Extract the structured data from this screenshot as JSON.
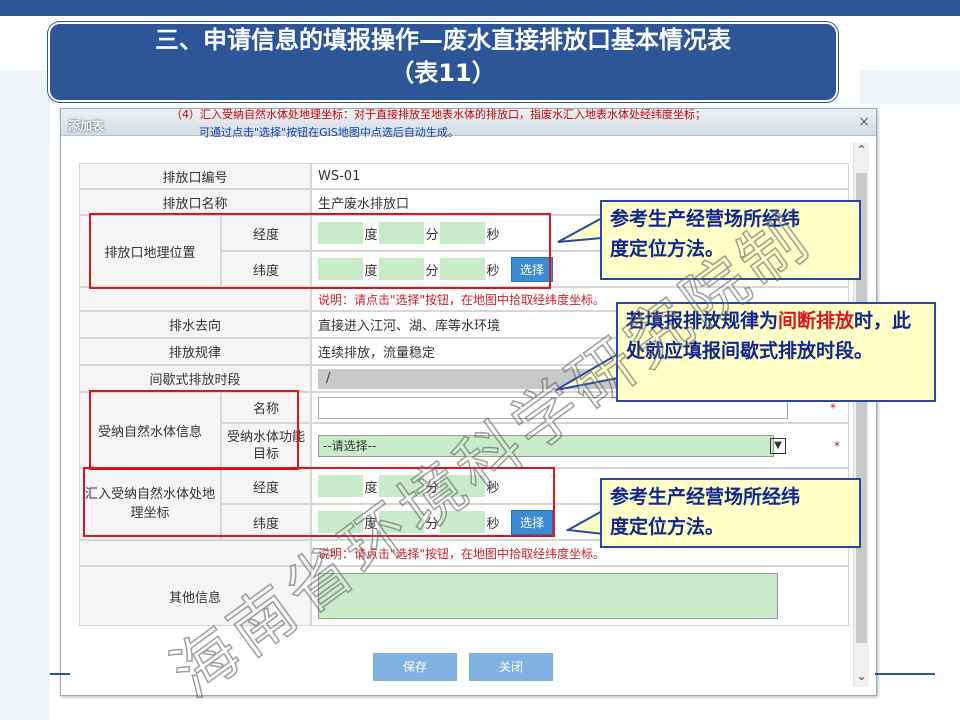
{
  "slide": {
    "title_line1": "三、申请信息的填报操作—废水直接排放口基本情况表",
    "title_line2": "（表11）"
  },
  "dialog": {
    "title": "添加表",
    "note_red": "（4）汇入受纳自然水体处地理坐标：对于直接排放至地表水体的排放口，指废水汇入地表水体处经纬度坐标；",
    "note_blue": "可通过点击\"选择\"按钮在GIS地图中点选后自动生成。",
    "close_glyph": "×"
  },
  "form": {
    "outlet_no_label": "排放口编号",
    "outlet_no_value": "WS-01",
    "outlet_name_label": "排放口名称",
    "outlet_name_value": "生产废水排放口",
    "geo_label": "排放口地理位置",
    "longitude_label": "经度",
    "latitude_label": "纬度",
    "unit_degree": "度",
    "unit_minute": "分",
    "unit_second": "秒",
    "select_button": "选择",
    "hint_1": "说明：请点击\"选择\"按钮，在地图中拾取经纬度坐标。",
    "direction_label": "排水去向",
    "direction_value": "直接进入江河、湖、库等水环境",
    "pattern_label": "排放规律",
    "pattern_value": "连续排放，流量稳定",
    "intermittent_label": "间歇式排放时段",
    "intermittent_value": "/",
    "receiving_label": "受纳自然水体信息",
    "name_label": "名称",
    "name_value": "",
    "function_label": "受纳水体功能目标",
    "function_value": "--请选择--",
    "required_mark": "*",
    "inflow_label": "汇入受纳自然水体处地理坐标",
    "inflow_lon_label": "经度",
    "inflow_lat_label": "纬度",
    "hint_2": "说明：请点击\"选择\"按钮，在地图中拾取经纬度坐标。",
    "other_label": "其他信息"
  },
  "buttons": {
    "save": "保存",
    "close": "关闭"
  },
  "callouts": {
    "c1_line1": "参考生产经营场所经纬",
    "c1_line2": "度定位方法。",
    "c2_part1": "若填报排放规律为",
    "c2_red": "间断排放",
    "c2_part2": "时，此处就应填报间歇式排放时段。",
    "c3_line1": "参考生产经营场所经纬",
    "c3_line2": "度定位方法。"
  },
  "watermark": "海南省环境科学研究院制",
  "colors": {
    "title_bg": "#2e5597",
    "callout_bg": "#ffffc8",
    "callout_text": "#13268f",
    "highlight": "#e0141e",
    "field_green": "#c9ebc9",
    "button_blue": "#3c8bd5"
  }
}
